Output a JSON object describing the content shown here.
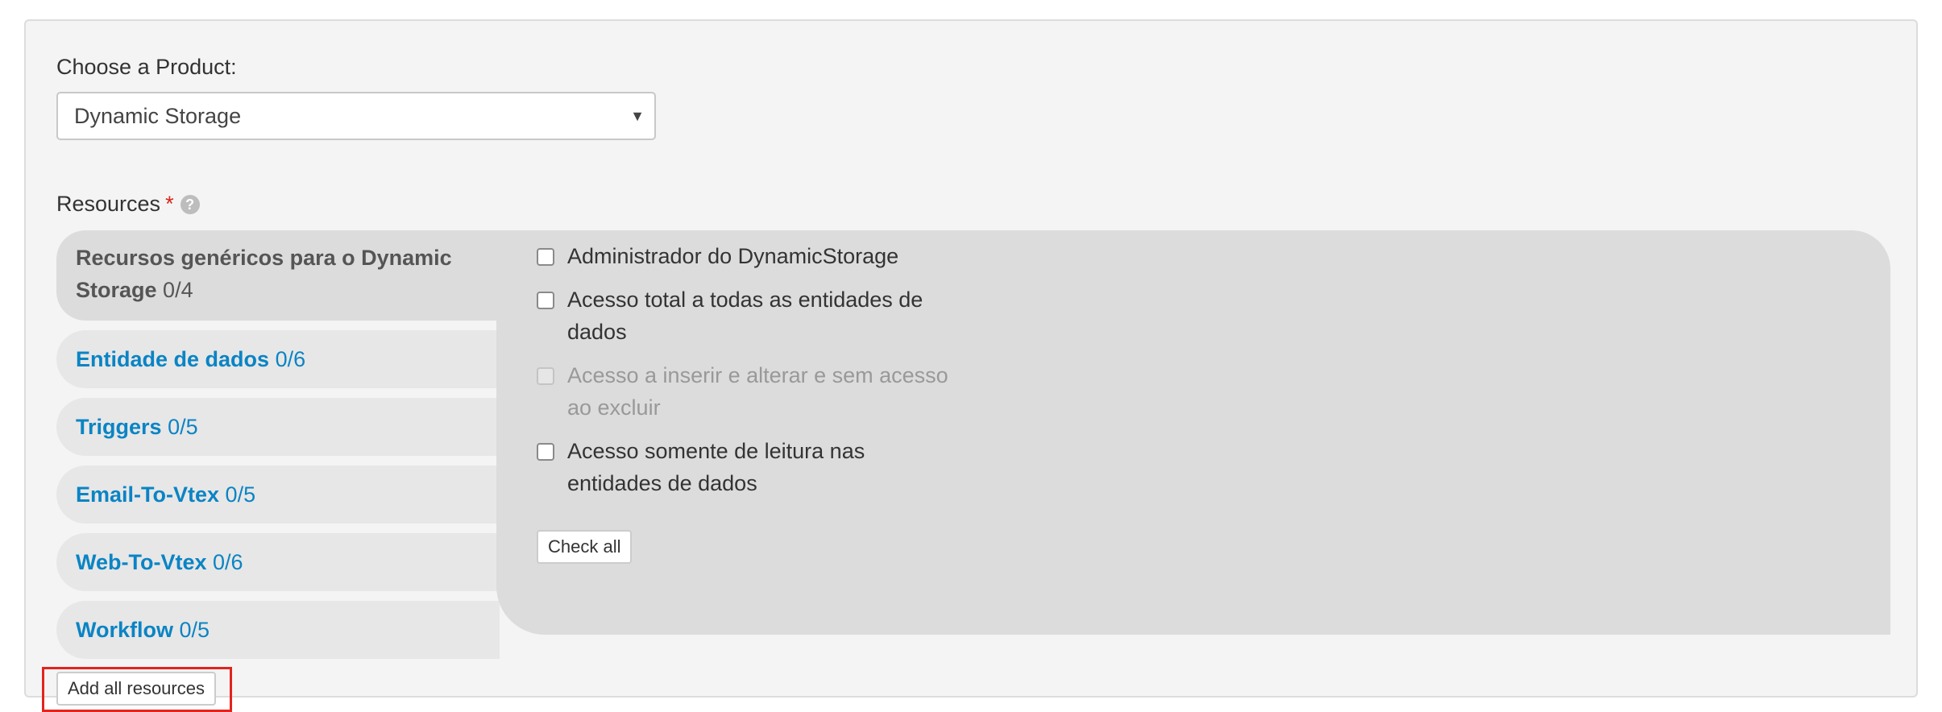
{
  "product": {
    "label": "Choose a Product:",
    "selected": "Dynamic Storage",
    "arrow_icon": "triangle-down-icon"
  },
  "resources": {
    "label": "Resources",
    "required_mark": "*",
    "help_icon": "?",
    "categories": [
      {
        "name": "Recursos genéricos para o Dynamic Storage",
        "count": "0/4",
        "active": true
      },
      {
        "name": "Entidade de dados",
        "count": "0/6",
        "active": false
      },
      {
        "name": "Triggers",
        "count": "0/5",
        "active": false
      },
      {
        "name": "Email-To-Vtex",
        "count": "0/5",
        "active": false
      },
      {
        "name": "Web-To-Vtex",
        "count": "0/6",
        "active": false
      },
      {
        "name": "Workflow",
        "count": "0/5",
        "active": false
      }
    ],
    "permissions": [
      {
        "label": "Administrador do DynamicStorage",
        "checked": false,
        "disabled": false
      },
      {
        "label": "Acesso total a todas as entidades de dados",
        "checked": false,
        "disabled": false
      },
      {
        "label": "Acesso a inserir e alterar e sem acesso ao excluir",
        "checked": false,
        "disabled": true
      },
      {
        "label": "Acesso somente de leitura nas entidades de dados",
        "checked": false,
        "disabled": false
      }
    ],
    "check_all_label": "Check all",
    "add_all_label": "Add all resources"
  },
  "colors": {
    "link": "#0a84c4",
    "required": "#d9261c",
    "highlight_outline": "#e3231d"
  }
}
